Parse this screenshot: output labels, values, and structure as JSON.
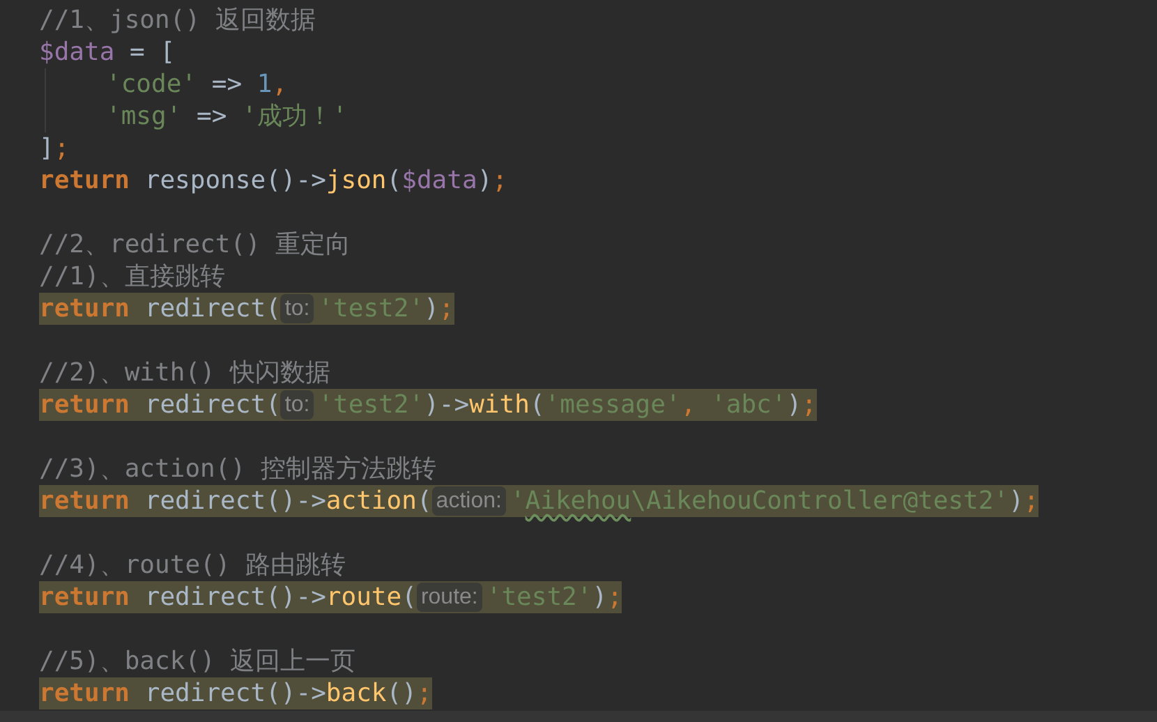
{
  "editor": {
    "lines": [
      {
        "kind": "code",
        "highlighted": false,
        "indented": false,
        "tokens": [
          {
            "kind": "comment",
            "text": "//1、json() 返回数据"
          }
        ]
      },
      {
        "kind": "code",
        "highlighted": false,
        "indented": false,
        "tokens": [
          {
            "kind": "variable",
            "text": "$data"
          },
          {
            "kind": "plain",
            "text": " = ["
          }
        ]
      },
      {
        "kind": "code",
        "highlighted": false,
        "indented": true,
        "tokens": [
          {
            "kind": "string",
            "text": "'code'"
          },
          {
            "kind": "plain",
            "text": " => "
          },
          {
            "kind": "number",
            "text": "1"
          },
          {
            "kind": "punct",
            "text": ","
          }
        ]
      },
      {
        "kind": "code",
        "highlighted": false,
        "indented": true,
        "tokens": [
          {
            "kind": "string",
            "text": "'msg'"
          },
          {
            "kind": "plain",
            "text": " => "
          },
          {
            "kind": "string",
            "text": "'成功！'"
          }
        ]
      },
      {
        "kind": "code",
        "highlighted": false,
        "indented": false,
        "tokens": [
          {
            "kind": "plain",
            "text": "]"
          },
          {
            "kind": "punct",
            "text": ";"
          }
        ]
      },
      {
        "kind": "code",
        "highlighted": false,
        "indented": false,
        "tokens": [
          {
            "kind": "keyword",
            "text": "return"
          },
          {
            "kind": "plain",
            "text": " response()->"
          },
          {
            "kind": "method",
            "text": "json"
          },
          {
            "kind": "plain",
            "text": "("
          },
          {
            "kind": "variable",
            "text": "$data"
          },
          {
            "kind": "plain",
            "text": ")"
          },
          {
            "kind": "punct",
            "text": ";"
          }
        ]
      },
      {
        "kind": "blank"
      },
      {
        "kind": "code",
        "highlighted": false,
        "indented": false,
        "tokens": [
          {
            "kind": "comment",
            "text": "//2、redirect() 重定向"
          }
        ]
      },
      {
        "kind": "code",
        "highlighted": false,
        "indented": false,
        "tokens": [
          {
            "kind": "comment",
            "text": "//1)、直接跳转"
          }
        ]
      },
      {
        "kind": "code",
        "highlighted": true,
        "indented": false,
        "tokens": [
          {
            "kind": "keyword",
            "text": "return"
          },
          {
            "kind": "plain",
            "text": " redirect("
          },
          {
            "kind": "hint",
            "text": "to:"
          },
          {
            "kind": "string",
            "text": "'test2'"
          },
          {
            "kind": "plain",
            "text": ")"
          },
          {
            "kind": "punct",
            "text": ";"
          }
        ]
      },
      {
        "kind": "blank"
      },
      {
        "kind": "code",
        "highlighted": false,
        "indented": false,
        "tokens": [
          {
            "kind": "comment",
            "text": "//2)、with() 快闪数据"
          }
        ]
      },
      {
        "kind": "code",
        "highlighted": true,
        "indented": false,
        "tokens": [
          {
            "kind": "keyword",
            "text": "return"
          },
          {
            "kind": "plain",
            "text": " redirect("
          },
          {
            "kind": "hint",
            "text": "to:"
          },
          {
            "kind": "string",
            "text": "'test2'"
          },
          {
            "kind": "plain",
            "text": ")->"
          },
          {
            "kind": "method",
            "text": "with"
          },
          {
            "kind": "plain",
            "text": "("
          },
          {
            "kind": "string",
            "text": "'message'"
          },
          {
            "kind": "punct",
            "text": ", "
          },
          {
            "kind": "string",
            "text": "'abc'"
          },
          {
            "kind": "plain",
            "text": ")"
          },
          {
            "kind": "punct",
            "text": ";"
          }
        ]
      },
      {
        "kind": "blank"
      },
      {
        "kind": "code",
        "highlighted": false,
        "indented": false,
        "tokens": [
          {
            "kind": "comment",
            "text": "//3)、action() 控制器方法跳转"
          }
        ]
      },
      {
        "kind": "code",
        "highlighted": true,
        "indented": false,
        "tokens": [
          {
            "kind": "keyword",
            "text": "return"
          },
          {
            "kind": "plain",
            "text": " redirect()->"
          },
          {
            "kind": "method",
            "text": "action"
          },
          {
            "kind": "plain",
            "text": "("
          },
          {
            "kind": "hint",
            "text": "action:"
          },
          {
            "kind": "string",
            "text": "'"
          },
          {
            "kind": "string",
            "text": "Aikehou",
            "typo": true
          },
          {
            "kind": "string",
            "text": "\\AikehouController@test2'"
          },
          {
            "kind": "plain",
            "text": ")"
          },
          {
            "kind": "punct",
            "text": ";"
          }
        ]
      },
      {
        "kind": "blank"
      },
      {
        "kind": "code",
        "highlighted": false,
        "indented": false,
        "tokens": [
          {
            "kind": "comment",
            "text": "//4)、route() 路由跳转"
          }
        ]
      },
      {
        "kind": "code",
        "highlighted": true,
        "indented": false,
        "tokens": [
          {
            "kind": "keyword",
            "text": "return"
          },
          {
            "kind": "plain",
            "text": " redirect()->"
          },
          {
            "kind": "method",
            "text": "route"
          },
          {
            "kind": "plain",
            "text": "("
          },
          {
            "kind": "hint",
            "text": "route:"
          },
          {
            "kind": "string",
            "text": "'test2'"
          },
          {
            "kind": "plain",
            "text": ")"
          },
          {
            "kind": "punct",
            "text": ";"
          }
        ]
      },
      {
        "kind": "blank"
      },
      {
        "kind": "code",
        "highlighted": false,
        "indented": false,
        "tokens": [
          {
            "kind": "comment",
            "text": "//5)、back() 返回上一页"
          }
        ]
      },
      {
        "kind": "code",
        "highlighted": true,
        "indented": false,
        "tokens": [
          {
            "kind": "keyword",
            "text": "return"
          },
          {
            "kind": "plain",
            "text": " redirect()->"
          },
          {
            "kind": "method",
            "text": "back"
          },
          {
            "kind": "plain",
            "text": "()"
          },
          {
            "kind": "punct",
            "text": ";"
          }
        ]
      }
    ]
  }
}
